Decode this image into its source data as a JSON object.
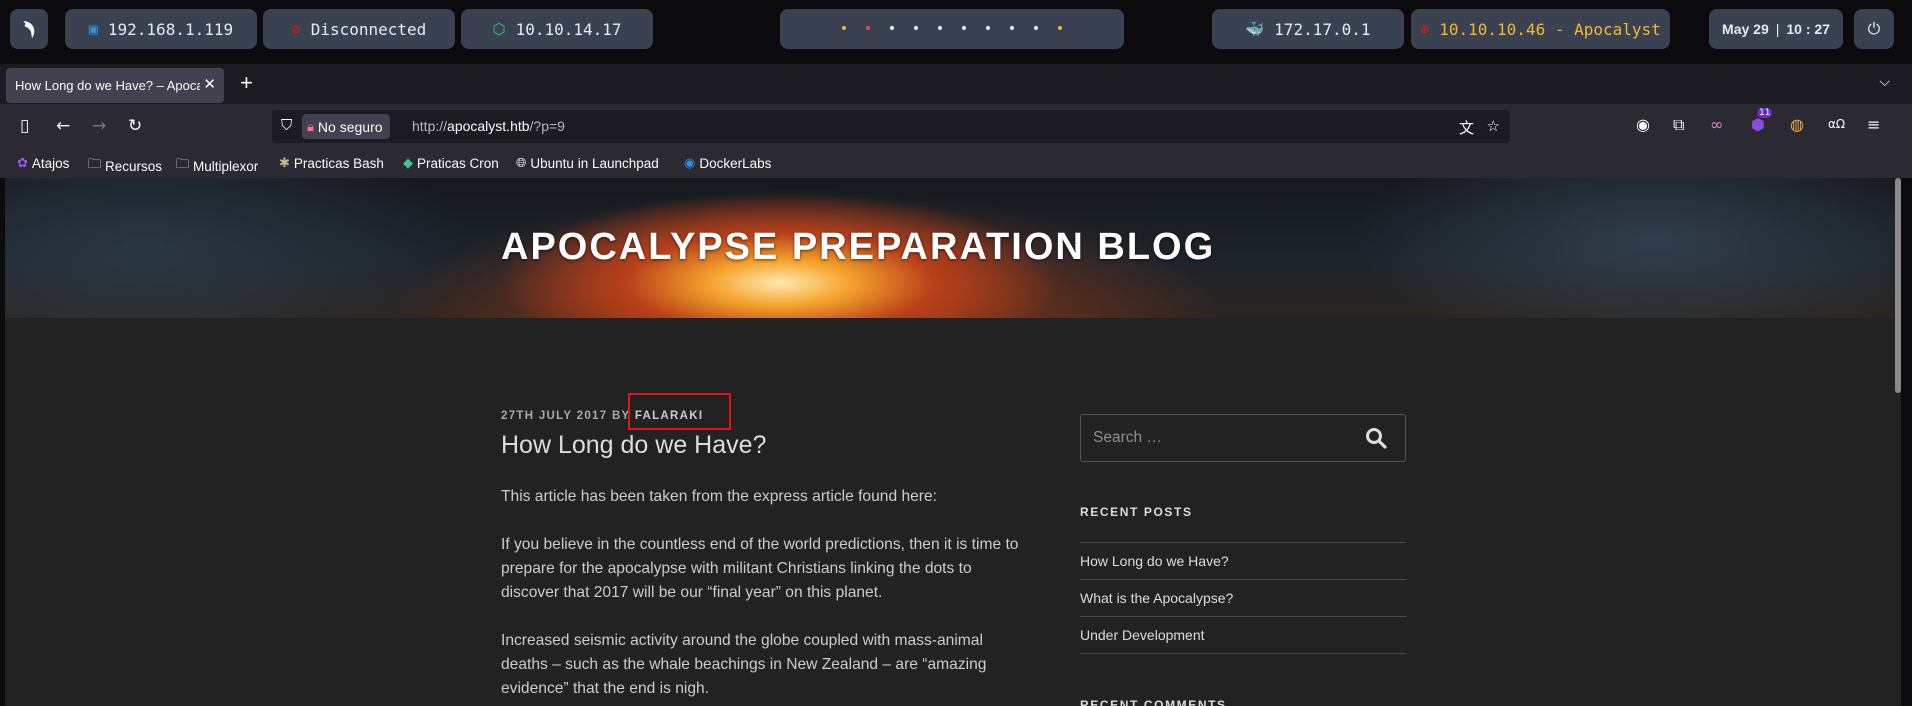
{
  "system_bar": {
    "local_ip": "192.168.1.119",
    "vpn_status": "Disconnected",
    "vpn_ip": "10.10.14.17",
    "workspace_dots": [
      "•",
      "•",
      "•",
      "•",
      "•",
      "•",
      "•",
      "•",
      "•",
      "•"
    ],
    "docker_ip": "172.17.0.1",
    "target": "10.10.10.46 - Apocalyst",
    "date": "May 29",
    "time": "10 : 27",
    "colors": {
      "pill": "#3a4150",
      "target": "#f7b731",
      "vpn_off": "#e0151b",
      "vpn_on": "#2ecc71",
      "docker": "#2e8fe6"
    }
  },
  "browser": {
    "tab_title": "How Long do we Have? – Apocalypse Preparation Blog",
    "security_label": "No seguro",
    "url_prefix": "http://",
    "url_host": "apocalyst.htb",
    "url_path": "/?p=9",
    "bookmarks": [
      "Atajos",
      "Recursos",
      "Multiplexor",
      "Practicas Bash",
      "Praticas Cron",
      "Ubuntu in Launchpad",
      "DockerLabs"
    ],
    "extension_badge": "11"
  },
  "blog": {
    "site_title": "APOCALYPSE PREPARATION BLOG",
    "post_date": "27TH JULY 2017",
    "by": "BY",
    "author": "FALARAKI",
    "post_title": "How Long do we Have?",
    "paragraphs": [
      "This article has been taken from the express article found here:",
      "If you believe in the countless end of the world predictions, then it is time to prepare for the apocalypse with militant Christians linking the dots to discover that 2017 will be our “final year” on this planet.",
      "Increased seismic activity around the globe coupled with mass-animal deaths – such as the whale beachings in New Zealand – are “amazing evidence” that the end is nigh."
    ],
    "search_placeholder": "Search …",
    "recent_posts_title": "RECENT POSTS",
    "recent_posts": [
      "How Long do we Have?",
      "What is the Apocalypse?",
      "Under Development"
    ],
    "recent_comments_title": "RECENT COMMENTS"
  }
}
